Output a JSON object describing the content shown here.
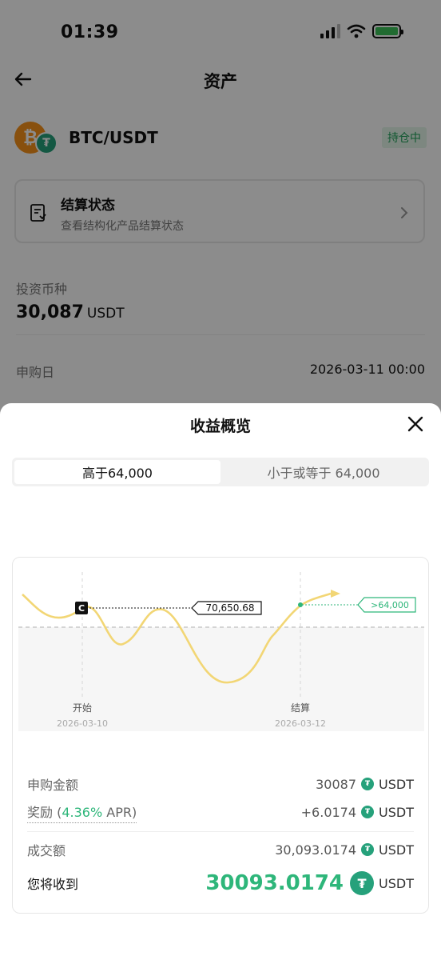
{
  "status_bar": {
    "time": "01:39"
  },
  "nav": {
    "title": "资产"
  },
  "pair": {
    "name": "BTC/USDT",
    "status": "持仓中",
    "btc_symbol": "₿",
    "usdt_symbol": "₮"
  },
  "settlement": {
    "title": "结算状态",
    "subtitle": "查看结构化产品结算状态"
  },
  "investment": {
    "label": "投资币种",
    "amount": "30,087",
    "unit": "USDT"
  },
  "subscription": {
    "label": "申购日",
    "value": "2026-03-11 00:00"
  },
  "sheet": {
    "title": "收益概览",
    "tabs": [
      {
        "label": "高于64,000",
        "active": true
      },
      {
        "label": "小于或等于 64,000",
        "active": false
      }
    ]
  },
  "chart": {
    "current_marker": "C",
    "current_price": "70,650.68",
    "target_label": ">64,000",
    "start_label": "开始",
    "start_date": "2026-03-10",
    "settle_label": "结算",
    "settle_date": "2026-03-12",
    "colors": {
      "curve": "#f2d675",
      "target": "#2eb67a"
    }
  },
  "summary": {
    "sub_amount_label": "申购金额",
    "sub_amount_value": "30087",
    "reward_label": "奖励",
    "reward_open": "(",
    "reward_apr": "4.36%",
    "reward_apr_suffix": "APR)",
    "reward_value": "+6.0174",
    "turnover_label": "成交额",
    "turnover_value": "30,093.0174",
    "receive_label": "您将收到",
    "receive_value": "30093.0174",
    "unit": "USDT",
    "usdt_symbol": "₮"
  }
}
